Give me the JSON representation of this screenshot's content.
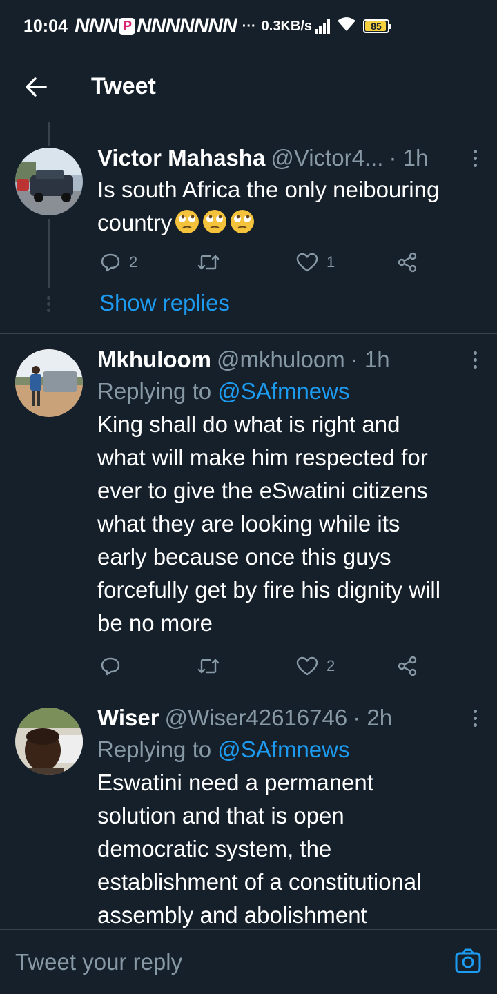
{
  "status_bar": {
    "time": "10:04",
    "notifications": [
      "N",
      "N",
      "N",
      "P",
      "N",
      "N",
      "N",
      "N",
      "N",
      "N",
      "N"
    ],
    "more_dots": "···",
    "net_speed": "0.3KB/s",
    "battery_level": "85",
    "battery_color": "#f4d03f"
  },
  "header": {
    "title": "Tweet",
    "back_icon": "arrow-left-icon"
  },
  "colors": {
    "background": "#15202b",
    "divider": "#38444d",
    "secondary_text": "#8899a6",
    "accent": "#1d9bf0"
  },
  "tweets": [
    {
      "name": "Victor Mahasha",
      "handle": "@Victor4...",
      "time": "· 1h",
      "body": "Is south Africa the only neibouring country",
      "emojis": [
        "face-with-rolling-eyes",
        "face-with-rolling-eyes",
        "face-with-rolling-eyes"
      ],
      "replies": "2",
      "retweets": "",
      "likes": "1",
      "show_replies": "Show replies"
    },
    {
      "name": "Mkhuloom",
      "handle": "@mkhuloom",
      "time": "· 1h",
      "replying_prefix": "Replying to ",
      "replying_to": "@SAfmnews",
      "body_lines": [
        "King shall do what is right and",
        "what will make him respected for",
        "ever to give the eSwatini citizens",
        "what they are looking while its",
        "early because once this guys",
        "forcefully get by fire his dignity will",
        "be no more"
      ],
      "replies": "",
      "retweets": "",
      "likes": "2"
    },
    {
      "name": "Wiser",
      "handle": "@Wiser42616746",
      "time": "· 2h",
      "replying_prefix": "Replying to ",
      "replying_to": "@SAfmnews",
      "body_lines": [
        "Eswatini need a permanent",
        "solution and that is open",
        "democratic system, the",
        "establishment of a constitutional",
        "assembly and abolishment"
      ]
    }
  ],
  "reply_bar": {
    "placeholder": "Tweet your reply",
    "camera_icon": "camera-icon"
  }
}
